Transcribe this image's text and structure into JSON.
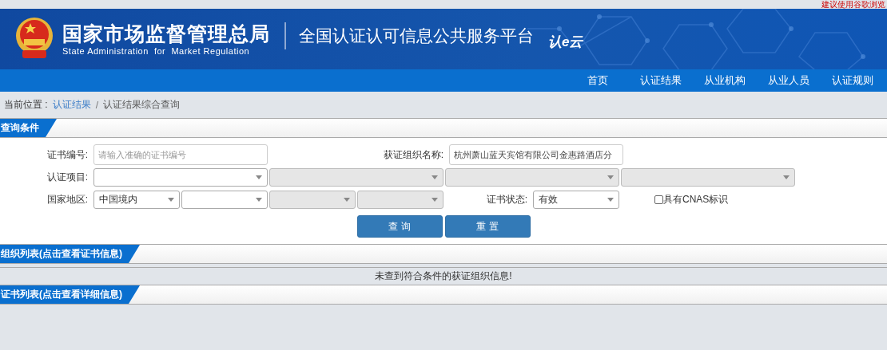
{
  "top_notice": "建议使用谷歌浏览",
  "header": {
    "title": "国家市场监督管理总局",
    "subtitle": "State Administration  for  Market Regulation",
    "platform": "全国认证认可信息公共服务平台",
    "logo": "认e云"
  },
  "nav": [
    {
      "label": "首页",
      "selected": false
    },
    {
      "label": "认证结果",
      "selected": false
    },
    {
      "label": "从业机构",
      "selected": false
    },
    {
      "label": "从业人员",
      "selected": false
    },
    {
      "label": "认证规则",
      "selected": false
    }
  ],
  "breadcrumb": {
    "prefix": "当前位置 :",
    "link": "认证结果",
    "separator": "/",
    "current": "认证结果综合查询"
  },
  "query_section": {
    "title": "查询条件"
  },
  "form_rows": [
    {
      "fields": [
        {
          "label": "证书编号:",
          "kind": "input",
          "placeholder": "请输入准确的证书编号"
        },
        {
          "label": "获证组织名称:",
          "kind": "input",
          "value": "杭州萧山蓝天宾馆有限公司金惠路酒店分"
        }
      ]
    },
    {
      "fields": [
        {
          "label": "认证项目:",
          "kind": "select",
          "disabled": false
        },
        {
          "kind": "select",
          "disabled": true
        },
        {
          "kind": "select",
          "disabled": true
        },
        {
          "kind": "select",
          "disabled": true
        }
      ]
    },
    {
      "fields": [
        {
          "label": "国家地区:",
          "kind": "select",
          "value": "中国境内",
          "disabled": false
        },
        {
          "kind": "select",
          "disabled": false
        },
        {
          "kind": "select",
          "disabled": true
        },
        {
          "kind": "select",
          "disabled": true
        },
        {
          "label": "证书状态:",
          "kind": "select",
          "value": "有效",
          "disabled": false
        },
        {
          "kind": "checkbox",
          "label": "具有CNAS标识",
          "checked": false
        }
      ]
    }
  ],
  "buttons": [
    "查 询",
    "重 置"
  ],
  "org_section": {
    "title": "组织列表(点击查看证书信息)",
    "message": "未查到符合条件的获证组织信息!"
  },
  "cert_section": {
    "title": "证书列表(点击查看详细信息)"
  }
}
